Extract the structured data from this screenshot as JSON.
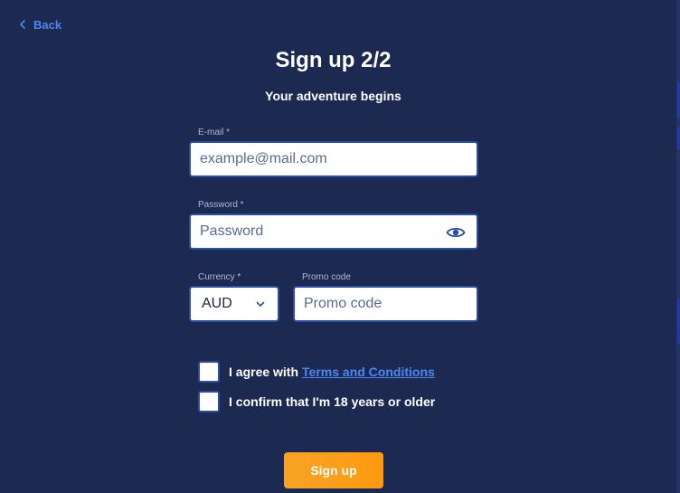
{
  "nav": {
    "back_label": "Back"
  },
  "header": {
    "title": "Sign up 2/2",
    "subtitle": "Your adventure begins"
  },
  "form": {
    "email": {
      "label": "E-mail *",
      "placeholder": "example@mail.com",
      "value": ""
    },
    "password": {
      "label": "Password *",
      "placeholder": "Password",
      "value": ""
    },
    "currency": {
      "label": "Currency *",
      "selected": "AUD"
    },
    "promo": {
      "label": "Promo code",
      "placeholder": "Promo code",
      "value": ""
    }
  },
  "checks": {
    "terms": {
      "prefix": "I agree with",
      "link": "Terms and Conditions",
      "checked": false
    },
    "age": {
      "label": "I confirm that I'm 18 years or older",
      "checked": false
    }
  },
  "submit": {
    "label": "Sign up"
  },
  "colors": {
    "background": "#1c2a52",
    "link": "#4d86f0",
    "input_border": "#2b4ca8",
    "button": "#f7a325",
    "label": "#aeb9d6"
  },
  "icons": {
    "back": "chevron-left-icon",
    "password_toggle": "eye-icon",
    "currency_dropdown": "chevron-down-icon"
  }
}
